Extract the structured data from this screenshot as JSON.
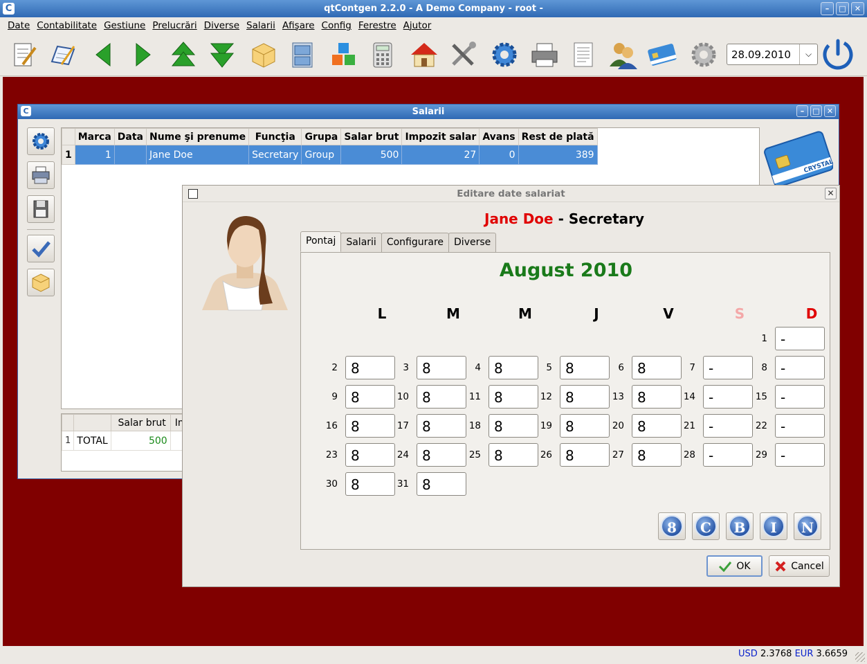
{
  "window": {
    "title": "qtContgen 2.2.0 - A Demo Company - root -"
  },
  "menu": [
    "Date",
    "Contabilitate",
    "Gestiune",
    "Prelucrări",
    "Diverse",
    "Salarii",
    "Afişare",
    "Config",
    "Ferestre",
    "Ajutor"
  ],
  "toolbar": {
    "date": "28.09.2010"
  },
  "status": {
    "usd_label": "USD",
    "usd_value": "2.3768",
    "eur_label": "EUR",
    "eur_value": "3.6659"
  },
  "salarii": {
    "title": "Salarii",
    "columns": [
      "Marca",
      "Data",
      "Nume şi prenume",
      "Funcţia",
      "Grupa",
      "Salar brut",
      "Impozit salar",
      "Avans",
      "Rest de plată"
    ],
    "row": {
      "index": "1",
      "marca": "1",
      "data": "",
      "nume": "Jane Doe",
      "functia": "Secretary",
      "grupa": "Group",
      "salar_brut": "500",
      "impozit": "27",
      "avans": "0",
      "rest": "389"
    },
    "totals": {
      "col_header": "Salar brut",
      "col_header2": "Im",
      "index": "1",
      "label": "TOTAL",
      "salar_brut": "500"
    }
  },
  "dialog": {
    "title": "Editare date salariat",
    "name": "Jane Doe",
    "separator": " - ",
    "position": "Secretary",
    "tabs": [
      "Pontaj",
      "Salarii",
      "Configurare",
      "Diverse"
    ],
    "month": "August 2010",
    "day_headers": [
      "L",
      "M",
      "M",
      "J",
      "V",
      "S",
      "D"
    ],
    "day_header_colors": [
      "#000000",
      "#000000",
      "#000000",
      "#000000",
      "#000000",
      "#f4a8a8",
      "#e00000"
    ],
    "days": [
      {
        "n": "1",
        "v": "-"
      },
      {
        "n": "2",
        "v": "8"
      },
      {
        "n": "3",
        "v": "8"
      },
      {
        "n": "4",
        "v": "8"
      },
      {
        "n": "5",
        "v": "8"
      },
      {
        "n": "6",
        "v": "8"
      },
      {
        "n": "7",
        "v": "-"
      },
      {
        "n": "8",
        "v": "-"
      },
      {
        "n": "9",
        "v": "8"
      },
      {
        "n": "10",
        "v": "8"
      },
      {
        "n": "11",
        "v": "8"
      },
      {
        "n": "12",
        "v": "8"
      },
      {
        "n": "13",
        "v": "8"
      },
      {
        "n": "14",
        "v": "-"
      },
      {
        "n": "15",
        "v": "-"
      },
      {
        "n": "16",
        "v": "8"
      },
      {
        "n": "17",
        "v": "8"
      },
      {
        "n": "18",
        "v": "8"
      },
      {
        "n": "19",
        "v": "8"
      },
      {
        "n": "20",
        "v": "8"
      },
      {
        "n": "21",
        "v": "-"
      },
      {
        "n": "22",
        "v": "-"
      },
      {
        "n": "23",
        "v": "8"
      },
      {
        "n": "24",
        "v": "8"
      },
      {
        "n": "25",
        "v": "8"
      },
      {
        "n": "26",
        "v": "8"
      },
      {
        "n": "27",
        "v": "8"
      },
      {
        "n": "28",
        "v": "-"
      },
      {
        "n": "29",
        "v": "-"
      },
      {
        "n": "30",
        "v": "8"
      },
      {
        "n": "31",
        "v": "8"
      }
    ],
    "code_buttons": [
      "8",
      "C",
      "B",
      "I",
      "N"
    ],
    "ok_label": "OK",
    "cancel_label": "Cancel"
  },
  "colors": {
    "titlebar": "#2f69b4",
    "desktop": "#800000",
    "selection": "#4a8cd6",
    "month": "#1a7a1a",
    "name": "#e00000",
    "total": "#1a8a1a"
  }
}
